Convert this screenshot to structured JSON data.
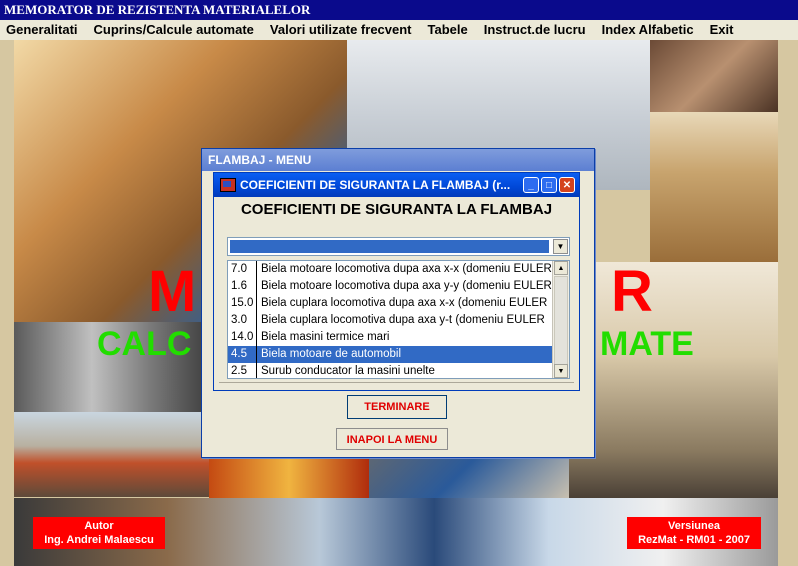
{
  "app_title": "MEMORATOR DE REZISTENTA MATERIALELOR",
  "menu": [
    "Generalitati",
    "Cuprins/Calcule automate",
    "Valori utilizate frecvent",
    "Tabele",
    "Instruct.de lucru",
    "Index Alfabetic",
    "Exit"
  ],
  "background_text": {
    "left_letter": "M",
    "right_letter": "R",
    "left_word": "CALC",
    "right_word": "MATE"
  },
  "badges": {
    "author_label": "Autor",
    "author_name": "Ing. Andrei Malaescu",
    "version_label": "Versiunea",
    "version_value": "RezMat - RM01 - 2007"
  },
  "outer_window": {
    "title": "FLAMBAJ - MENU",
    "back_button": "INAPOI LA MENU"
  },
  "inner_window": {
    "title": "COEFICIENTI DE SIGURANTA LA FLAMBAJ (r...",
    "heading": "COEFICIENTI DE SIGURANTA LA FLAMBAJ",
    "combo_value": "",
    "rows": [
      {
        "value": "7.0",
        "desc": "Biela motoare locomotiva dupa axa x-x  (domeniu EULER"
      },
      {
        "value": "1.6",
        "desc": "Biela motoare locomotiva dupa axa y-y  (domeniu EULER"
      },
      {
        "value": "15.0",
        "desc": "Biela cuplara locomotiva dupa axa x-x  (domeniu EULER"
      },
      {
        "value": "3.0",
        "desc": "Biela cuplara locomotiva dupa axa y-t  (domeniu EULER"
      },
      {
        "value": "14.0",
        "desc": "Biela masini termice mari"
      },
      {
        "value": "4.5",
        "desc": "Biela motoare de automobil"
      },
      {
        "value": "2.5",
        "desc": "Surub conducator la masini unelte"
      }
    ],
    "selected_row": 5,
    "terminate_button": "TERMINARE"
  },
  "colors": {
    "title_bar": "#0a0a8c",
    "accent_red": "#ff0000",
    "accent_green": "#22dd00",
    "selection": "#316ac5"
  }
}
